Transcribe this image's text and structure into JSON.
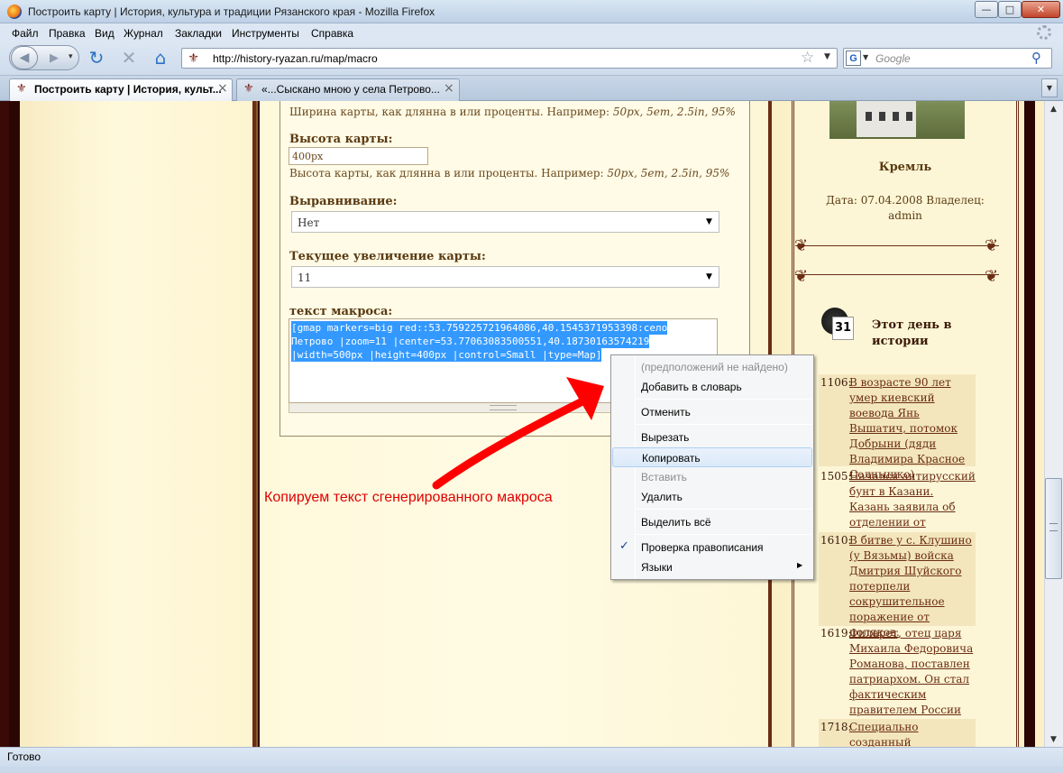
{
  "window": {
    "title": "Построить карту | История, культура и традиции Рязанского края - Mozilla Firefox",
    "minimize_icon": "minimize-icon",
    "maximize_icon": "maximize-icon",
    "close_icon": "close-icon"
  },
  "menubar": {
    "items": [
      "Файл",
      "Правка",
      "Вид",
      "Журнал",
      "Закладки",
      "Инструменты",
      "Справка"
    ]
  },
  "navbar": {
    "url": "http://history-ryazan.ru/map/macro",
    "search_placeholder": "Google",
    "search_engine_letter": "G"
  },
  "tabs": [
    {
      "label": "Построить карту | История, культ...",
      "active": true
    },
    {
      "label": "«...Сыскано мною у села Петрово...",
      "active": false
    }
  ],
  "form": {
    "width_hint_text": "Ширина карты, как длянна в или проценты. Например: ",
    "width_hint_examples": "50px, 5em, 2.5in, 95%",
    "height_label": "Высота карты:",
    "height_value": "400px",
    "height_hint_text": "Высота карты, как длянна в или проценты. Например: ",
    "height_hint_examples": "50px, 5em, 2.5in, 95%",
    "align_label": "Выравнивание:",
    "align_value": "Нет",
    "zoom_label": "Текущее увеличение карты:",
    "zoom_value": "11",
    "macro_label": "текст макроса:",
    "macro_lines": [
      "[gmap markers=big red::53.759225721964086,40.1545371953398:село",
      "Петрово |zoom=11 |center=53.77063083500551,40.18730163574219",
      "|width=500px |height=400px |control=Small |type=Map]"
    ]
  },
  "annotation": "Копируем текст сгенерированного макроса",
  "context_menu": {
    "items": [
      {
        "label": "(предположений не найдено)",
        "disabled": true
      },
      {
        "label": "Добавить в словарь"
      },
      {
        "label": "Отменить"
      },
      {
        "label": "Вырезать"
      },
      {
        "label": "Копировать",
        "hover": true
      },
      {
        "label": "Вставить",
        "disabled": true
      },
      {
        "label": "Удалить"
      },
      {
        "label": "Выделить всё"
      },
      {
        "label": "Проверка правописания",
        "checked": true
      },
      {
        "label": "Языки",
        "submenu": true
      }
    ]
  },
  "sidebar": {
    "photo_title": "Кремль",
    "photo_meta": "Дата: 07.04.2008 Владелец: admin",
    "history_title": "Этот день в истории",
    "calendar_number": "31",
    "events": [
      {
        "year": "1106:",
        "text": "В возрасте 90 лет умер киевский воевода Янь Вышатич, потомок Добрыни (дяди Владимира Красное Солнышко)"
      },
      {
        "year": "1505:",
        "text": "Начался антирусский бунт в Казани. Казань заявила об отделении от Москвы."
      },
      {
        "year": "1610:",
        "text": "В битве у с. Клушино (у Вязьмы) войска Дмитрия Шуйского потерпели сокрушительное поражение от поляков."
      },
      {
        "year": "1619:",
        "text": "Филарет, отец царя Михаила Федоровича Романова, поставлен патриархом. Он стал фактическим правителем России"
      },
      {
        "year": "1718:",
        "text": "Специально созданный Верховный суд"
      }
    ]
  },
  "status": {
    "text": "Готово"
  }
}
